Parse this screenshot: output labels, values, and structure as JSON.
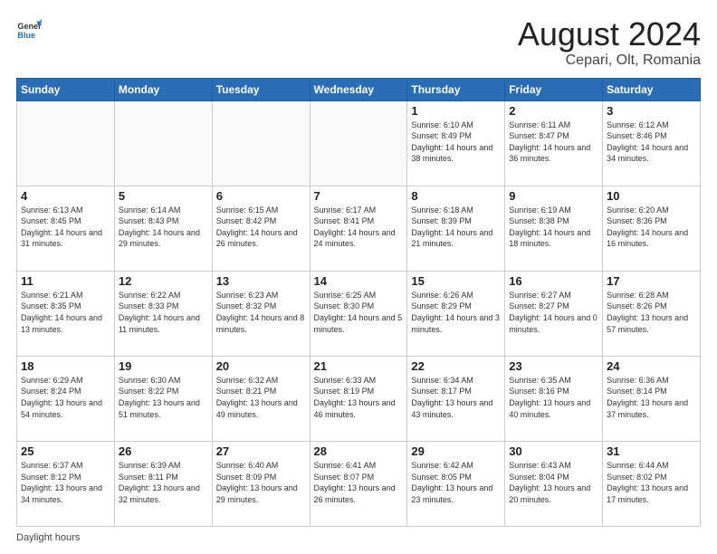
{
  "header": {
    "logo": {
      "text_general": "General",
      "text_blue": "Blue"
    },
    "title": "August 2024",
    "subtitle": "Cepari, Olt, Romania"
  },
  "calendar": {
    "days_of_week": [
      "Sunday",
      "Monday",
      "Tuesday",
      "Wednesday",
      "Thursday",
      "Friday",
      "Saturday"
    ],
    "weeks": [
      [
        {
          "day": "",
          "info": ""
        },
        {
          "day": "",
          "info": ""
        },
        {
          "day": "",
          "info": ""
        },
        {
          "day": "",
          "info": ""
        },
        {
          "day": "1",
          "info": "Sunrise: 6:10 AM\nSunset: 8:49 PM\nDaylight: 14 hours and 38 minutes."
        },
        {
          "day": "2",
          "info": "Sunrise: 6:11 AM\nSunset: 8:47 PM\nDaylight: 14 hours and 36 minutes."
        },
        {
          "day": "3",
          "info": "Sunrise: 6:12 AM\nSunset: 8:46 PM\nDaylight: 14 hours and 34 minutes."
        }
      ],
      [
        {
          "day": "4",
          "info": "Sunrise: 6:13 AM\nSunset: 8:45 PM\nDaylight: 14 hours and 31 minutes."
        },
        {
          "day": "5",
          "info": "Sunrise: 6:14 AM\nSunset: 8:43 PM\nDaylight: 14 hours and 29 minutes."
        },
        {
          "day": "6",
          "info": "Sunrise: 6:15 AM\nSunset: 8:42 PM\nDaylight: 14 hours and 26 minutes."
        },
        {
          "day": "7",
          "info": "Sunrise: 6:17 AM\nSunset: 8:41 PM\nDaylight: 14 hours and 24 minutes."
        },
        {
          "day": "8",
          "info": "Sunrise: 6:18 AM\nSunset: 8:39 PM\nDaylight: 14 hours and 21 minutes."
        },
        {
          "day": "9",
          "info": "Sunrise: 6:19 AM\nSunset: 8:38 PM\nDaylight: 14 hours and 18 minutes."
        },
        {
          "day": "10",
          "info": "Sunrise: 6:20 AM\nSunset: 8:36 PM\nDaylight: 14 hours and 16 minutes."
        }
      ],
      [
        {
          "day": "11",
          "info": "Sunrise: 6:21 AM\nSunset: 8:35 PM\nDaylight: 14 hours and 13 minutes."
        },
        {
          "day": "12",
          "info": "Sunrise: 6:22 AM\nSunset: 8:33 PM\nDaylight: 14 hours and 11 minutes."
        },
        {
          "day": "13",
          "info": "Sunrise: 6:23 AM\nSunset: 8:32 PM\nDaylight: 14 hours and 8 minutes."
        },
        {
          "day": "14",
          "info": "Sunrise: 6:25 AM\nSunset: 8:30 PM\nDaylight: 14 hours and 5 minutes."
        },
        {
          "day": "15",
          "info": "Sunrise: 6:26 AM\nSunset: 8:29 PM\nDaylight: 14 hours and 3 minutes."
        },
        {
          "day": "16",
          "info": "Sunrise: 6:27 AM\nSunset: 8:27 PM\nDaylight: 14 hours and 0 minutes."
        },
        {
          "day": "17",
          "info": "Sunrise: 6:28 AM\nSunset: 8:26 PM\nDaylight: 13 hours and 57 minutes."
        }
      ],
      [
        {
          "day": "18",
          "info": "Sunrise: 6:29 AM\nSunset: 8:24 PM\nDaylight: 13 hours and 54 minutes."
        },
        {
          "day": "19",
          "info": "Sunrise: 6:30 AM\nSunset: 8:22 PM\nDaylight: 13 hours and 51 minutes."
        },
        {
          "day": "20",
          "info": "Sunrise: 6:32 AM\nSunset: 8:21 PM\nDaylight: 13 hours and 49 minutes."
        },
        {
          "day": "21",
          "info": "Sunrise: 6:33 AM\nSunset: 8:19 PM\nDaylight: 13 hours and 46 minutes."
        },
        {
          "day": "22",
          "info": "Sunrise: 6:34 AM\nSunset: 8:17 PM\nDaylight: 13 hours and 43 minutes."
        },
        {
          "day": "23",
          "info": "Sunrise: 6:35 AM\nSunset: 8:16 PM\nDaylight: 13 hours and 40 minutes."
        },
        {
          "day": "24",
          "info": "Sunrise: 6:36 AM\nSunset: 8:14 PM\nDaylight: 13 hours and 37 minutes."
        }
      ],
      [
        {
          "day": "25",
          "info": "Sunrise: 6:37 AM\nSunset: 8:12 PM\nDaylight: 13 hours and 34 minutes."
        },
        {
          "day": "26",
          "info": "Sunrise: 6:39 AM\nSunset: 8:11 PM\nDaylight: 13 hours and 32 minutes."
        },
        {
          "day": "27",
          "info": "Sunrise: 6:40 AM\nSunset: 8:09 PM\nDaylight: 13 hours and 29 minutes."
        },
        {
          "day": "28",
          "info": "Sunrise: 6:41 AM\nSunset: 8:07 PM\nDaylight: 13 hours and 26 minutes."
        },
        {
          "day": "29",
          "info": "Sunrise: 6:42 AM\nSunset: 8:05 PM\nDaylight: 13 hours and 23 minutes."
        },
        {
          "day": "30",
          "info": "Sunrise: 6:43 AM\nSunset: 8:04 PM\nDaylight: 13 hours and 20 minutes."
        },
        {
          "day": "31",
          "info": "Sunrise: 6:44 AM\nSunset: 8:02 PM\nDaylight: 13 hours and 17 minutes."
        }
      ]
    ]
  },
  "footer": {
    "note": "Daylight hours"
  }
}
